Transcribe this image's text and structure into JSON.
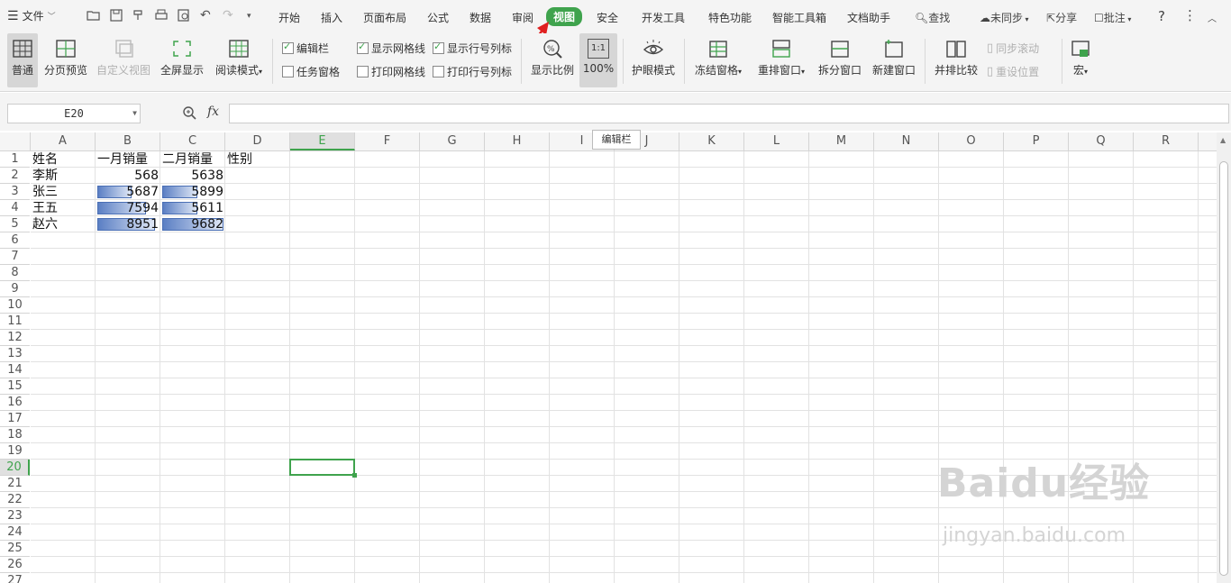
{
  "menu": {
    "file_label": "文件",
    "tabs": [
      "开始",
      "插入",
      "页面布局",
      "公式",
      "数据",
      "审阅",
      "视图",
      "安全",
      "开发工具",
      "特色功能",
      "智能工具箱",
      "文档助手"
    ],
    "active_tab": "视图",
    "search_label": "查找",
    "sync_label": "未同步",
    "share_label": "分享",
    "comment_label": "批注"
  },
  "ribbon": {
    "normal": "普通",
    "page_preview": "分页预览",
    "custom_view": "自定义视图",
    "fullscreen": "全屏显示",
    "reading_mode": "阅读模式",
    "edit_bar": "编辑栏",
    "task_pane": "任务窗格",
    "show_grid": "显示网格线",
    "print_grid": "打印网格线",
    "show_headers": "显示行号列标",
    "print_headers": "打印行号列标",
    "zoom_ratio": "显示比例",
    "zoom_100": "100%",
    "zoom_100_icon": "1:1",
    "eye_mode": "护眼模式",
    "freeze": "冻结窗格",
    "arrange": "重排窗口",
    "split": "拆分窗口",
    "new_window": "新建窗口",
    "side_by_side": "并排比较",
    "sync_scroll": "同步滚动",
    "reset_pos": "重设位置",
    "macro": "宏"
  },
  "formula_bar": {
    "name_box": "E20",
    "fx": "fx",
    "tooltip": "编辑栏"
  },
  "sheet": {
    "columns": [
      "A",
      "B",
      "C",
      "D",
      "E",
      "F",
      "G",
      "H",
      "I",
      "J",
      "K",
      "L",
      "M",
      "N",
      "O",
      "P",
      "Q",
      "R"
    ],
    "selected_column": "E",
    "rows": [
      "1",
      "2",
      "3",
      "4",
      "5",
      "6",
      "7",
      "8",
      "9",
      "10",
      "11",
      "12",
      "13",
      "14",
      "15",
      "16",
      "17",
      "18",
      "19",
      "20",
      "21",
      "22",
      "23",
      "24",
      "25",
      "26",
      "27"
    ],
    "selected_row": "20",
    "headers": [
      "姓名",
      "一月销量",
      "二月销量",
      "性别"
    ],
    "data": [
      {
        "name": "李斯",
        "jan": "568",
        "feb": "5638",
        "jan_fill": 0.0,
        "feb_fill": 0.0
      },
      {
        "name": "张三",
        "jan": "5687",
        "feb": "5899",
        "jan_fill": 0.56,
        "feb_fill": 0.58
      },
      {
        "name": "王五",
        "jan": "7594",
        "feb": "5611",
        "jan_fill": 0.79,
        "feb_fill": 0.57
      },
      {
        "name": "赵六",
        "jan": "8951",
        "feb": "9682",
        "jan_fill": 0.94,
        "feb_fill": 1.0
      }
    ]
  },
  "watermark": {
    "logo": "Baidu经验",
    "url": "jingyan.baidu.com"
  },
  "colors": {
    "accent": "#3fa34d",
    "databar": "#5b7fc4",
    "arrow": "#e02020"
  }
}
